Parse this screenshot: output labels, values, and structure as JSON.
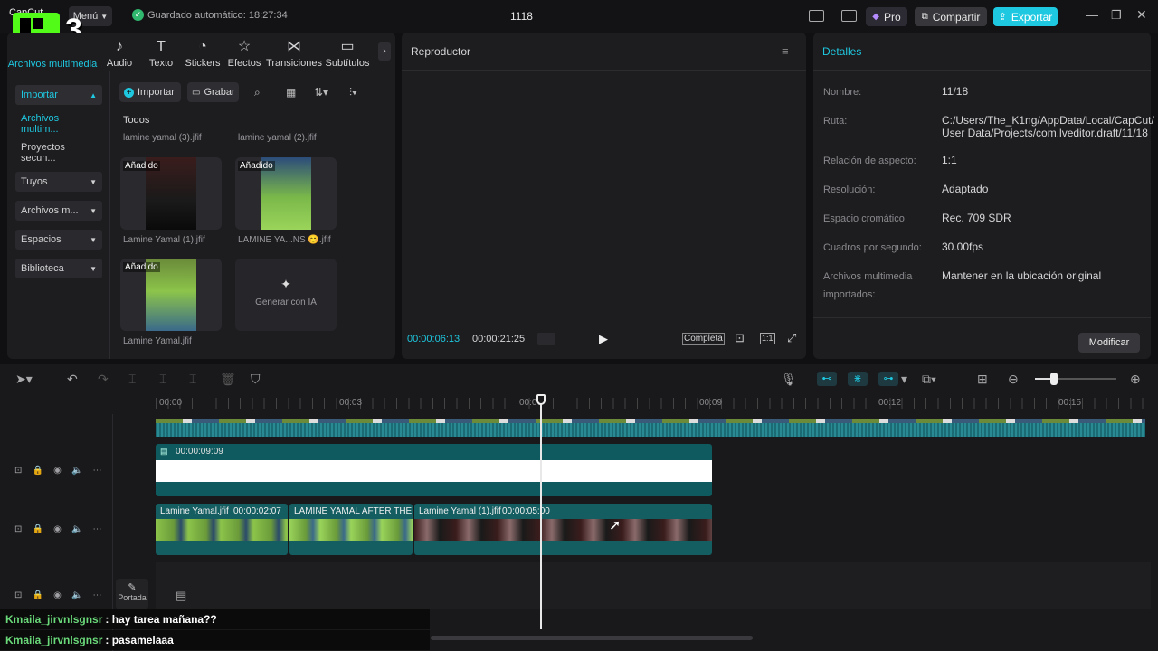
{
  "topbar": {
    "logo_text": "CapCut",
    "menu_label": "Menú",
    "autosave": "Guardado automático: 18:27:34",
    "project_title": "1118",
    "pro_label": "Pro",
    "share_label": "Compartir",
    "export_label": "Exportar",
    "overlay_badge": "3",
    "accent": "#1ec8e0"
  },
  "media_tabs": [
    {
      "label": "Archivos multimedia",
      "icon": "media-icon"
    },
    {
      "label": "Audio",
      "icon": "audio-icon"
    },
    {
      "label": "Texto",
      "icon": "text-icon"
    },
    {
      "label": "Stickers",
      "icon": "sticker-icon"
    },
    {
      "label": "Efectos",
      "icon": "effects-icon"
    },
    {
      "label": "Transiciones",
      "icon": "transitions-icon"
    },
    {
      "label": "Subtítulos",
      "icon": "subtitles-icon"
    }
  ],
  "sidebar": {
    "items": [
      {
        "label": "Importar"
      },
      {
        "label": "Archivos multim..."
      },
      {
        "label": "Proyectos secun..."
      },
      {
        "label": "Tuyos"
      },
      {
        "label": "Archivos m..."
      },
      {
        "label": "Espacios"
      },
      {
        "label": "Biblioteca"
      }
    ]
  },
  "media": {
    "import_label": "Importar",
    "record_label": "Grabar",
    "filter_all": "Todos",
    "top_names": [
      "lamine yamal (3).jfif",
      "lamine yamal (2).jfif"
    ],
    "added_tag": "Añadido",
    "items": [
      {
        "name": "Lamine Yamal (1).jfif"
      },
      {
        "name": "LAMINE YA...NS 😊.jfif"
      },
      {
        "name": "Lamine Yamal.jfif"
      }
    ],
    "generate_label": "Generar con IA"
  },
  "player": {
    "title": "Reproductor",
    "current_time": "00:00:06:13",
    "total_time": "00:00:21:25",
    "complete_label": "Completa",
    "ratio_label": "1:1"
  },
  "details": {
    "title": "Detalles",
    "rows": [
      {
        "label": "Nombre:",
        "value": "11/18"
      },
      {
        "label": "Ruta:",
        "value": "C:/Users/The_K1ng/AppData/Local/CapCut/"
      },
      {
        "label": "",
        "value": "User Data/Projects/com.lveditor.draft/11/18"
      },
      {
        "label": "Relación de aspecto:",
        "value": "1:1"
      },
      {
        "label": "Resolución:",
        "value": "Adaptado"
      },
      {
        "label": "Espacio cromático",
        "value": "Rec. 709 SDR"
      },
      {
        "label": "Cuadros por segundo:",
        "value": "30.00fps"
      },
      {
        "label": "Archivos multimedia",
        "value": "Mantener en la ubicación original"
      },
      {
        "label": "importados:",
        "value": ""
      }
    ],
    "modify_label": "Modificar"
  },
  "timeline": {
    "ticks": [
      "00:00",
      "00:03",
      "00:06",
      "00:09",
      "00:12",
      "00:15"
    ],
    "text_clip_duration": "00:00:09:09",
    "clips": [
      {
        "name": "Lamine Yamal.jfif",
        "duration": "00:00:02:07"
      },
      {
        "name": "LAMINE YAMAL AFTER THE SI",
        "duration": ""
      },
      {
        "name": "Lamine Yamal (1).jfif",
        "duration": "00:00:05:00"
      }
    ],
    "cover_label": "Portada"
  },
  "chat": [
    {
      "user": "Kmaila_jirvnlsgnsr",
      "message": ": hay tarea mañana??"
    },
    {
      "user": "Kmaila_jirvnlsgnsr",
      "message": ": pasamelaaa"
    }
  ]
}
